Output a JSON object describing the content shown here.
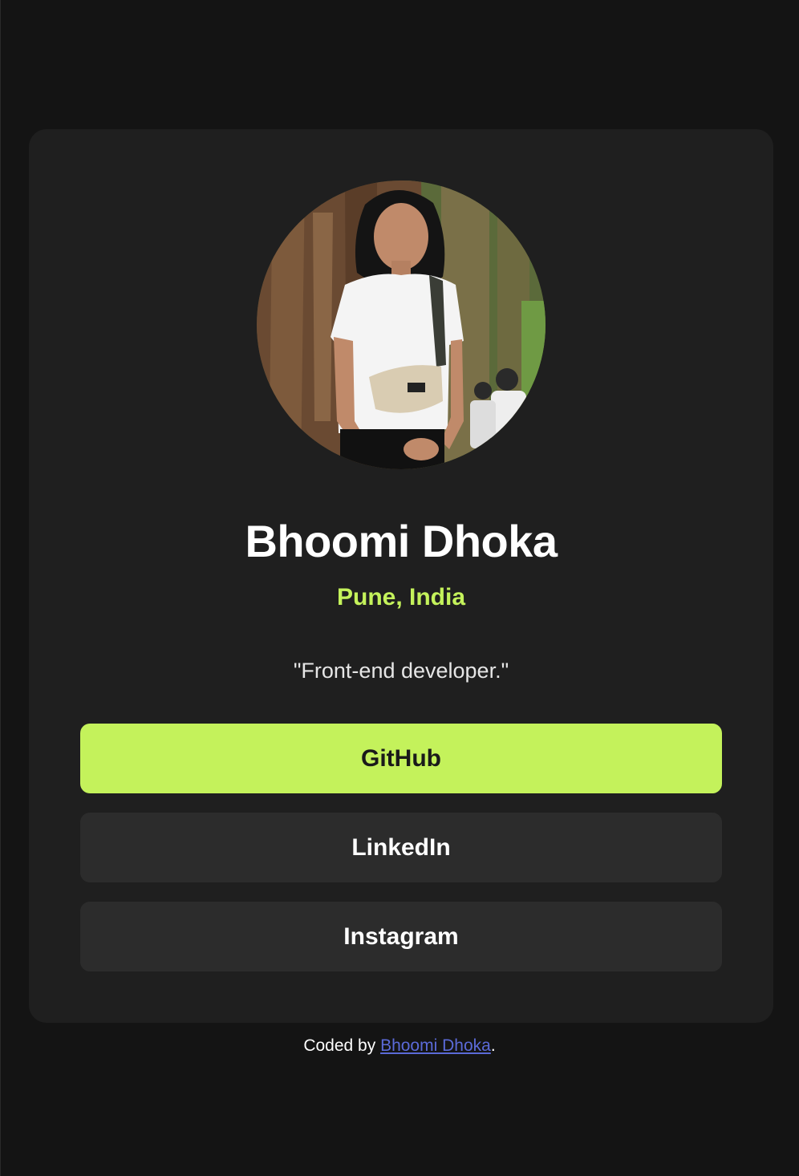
{
  "profile": {
    "avatar_icon": "profile-photo",
    "name": "Bhoomi Dhoka",
    "location": "Pune, India",
    "bio": "\"Front-end developer.\""
  },
  "links": [
    {
      "label": "GitHub",
      "style": "primary"
    },
    {
      "label": "LinkedIn",
      "style": "default"
    },
    {
      "label": "Instagram",
      "style": "default"
    }
  ],
  "footer": {
    "prefix": "Coded by ",
    "author_link": "Bhoomi Dhoka",
    "suffix": "."
  },
  "colors": {
    "background": "#141414",
    "card": "#1f1f1f",
    "accent": "#c4f25b",
    "button": "#2c2c2c",
    "footer_link": "#5b6ad8"
  }
}
